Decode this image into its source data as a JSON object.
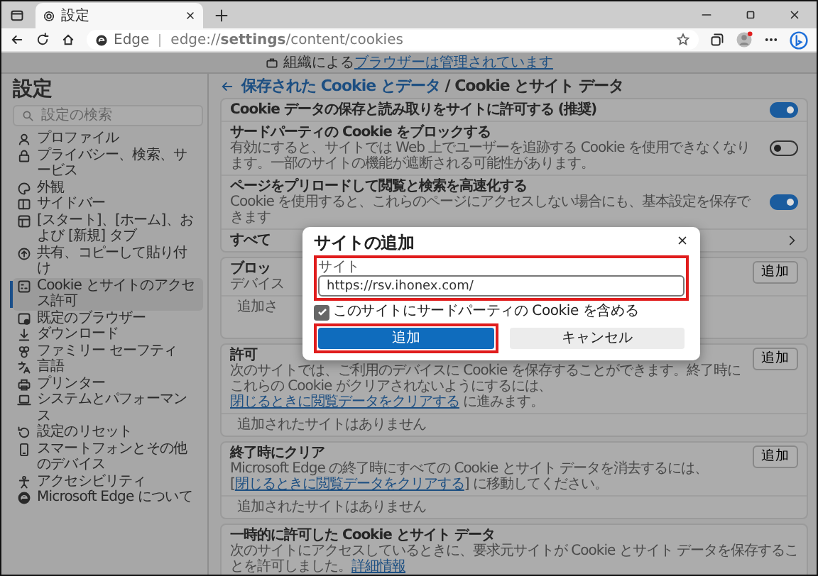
{
  "browser": {
    "tab": {
      "title": "設定"
    },
    "address": {
      "site_label": "Edge",
      "url": "edge://**settings**/content/cookies"
    }
  },
  "managed_notice": {
    "text": "組織による",
    "link": "ブラウザーは管理されています"
  },
  "sidebar": {
    "title": "設定",
    "search": {
      "placeholder": "設定の検索"
    },
    "items": [
      {
        "label": "プロファイル",
        "selected": false
      },
      {
        "label": "プライバシー、検索、サービス",
        "selected": false
      },
      {
        "label": "外観",
        "selected": false
      },
      {
        "label": "サイドバー",
        "selected": false
      },
      {
        "label": "[スタート]、[ホーム]、および [新規] タブ",
        "selected": false
      },
      {
        "label": "共有、コピーして貼り付け",
        "selected": false
      },
      {
        "label": "Cookie とサイトのアクセス許可",
        "selected": true
      },
      {
        "label": "既定のブラウザー",
        "selected": false
      },
      {
        "label": "ダウンロード",
        "selected": false
      },
      {
        "label": "ファミリー セーフティ",
        "selected": false
      },
      {
        "label": "言語",
        "selected": false
      },
      {
        "label": "プリンター",
        "selected": false
      },
      {
        "label": "システムとパフォーマンス",
        "selected": false
      },
      {
        "label": "設定のリセット",
        "selected": false
      },
      {
        "label": "スマートフォンとその他のデバイス",
        "selected": false
      },
      {
        "label": "アクセシビリティ",
        "selected": false
      },
      {
        "label": "Microsoft Edge について",
        "selected": false
      }
    ]
  },
  "page": {
    "breadcrumb_link": "保存された Cookie とデータ",
    "title": "/ Cookie とサイト データ"
  },
  "settings": [
    {
      "title": "Cookie データの保存と読み取りをサイトに許可する (推奨)",
      "on": true
    },
    {
      "title": "サードパーティの Cookie をブロックする",
      "description": "有効にすると、サイトでは Web 上でユーザーを追跡する Cookie を使用できなくなります。一部のサイトの機能が遮断される可能性があります。",
      "on": false
    },
    {
      "title": "ページをプリロードして閲覧と検索を高速化する",
      "description": "Cookie を使用すると、これらのページにアクセスしない場合にも、基本設定を保存できます",
      "on": true
    }
  ],
  "all_row": {
    "label": "すべて"
  },
  "sections": [
    {
      "title": "ブロッ",
      "description": "デバイス",
      "empty": "追加さ",
      "button": "追加"
    },
    {
      "title": "許可",
      "description": "次のサイトでは、ご利用のデバイスに Cookie を保存することができます。終了時にこれらの Cookie がクリアされないようにするには、",
      "link": "閉じるときに閲覧データをクリアする",
      "after": " に進みます。",
      "empty": "追加されたサイトはありません",
      "button": "追加"
    },
    {
      "title": "終了時にクリア",
      "description": "Microsoft Edge の終了時にすべての Cookie とサイト データを消去するには、[",
      "link": "閉じるときに閲覧データをクリアする",
      "after": "] に移動してください。",
      "empty": "追加されたサイトはありません",
      "button": "追加"
    },
    {
      "title": "一時的に許可した Cookie とサイト データ",
      "description": "次のサイトにアクセスしているときに、要求元サイトが Cookie とサイト データを保存することを許可しました。",
      "link": "詳細情報"
    }
  ],
  "dialog": {
    "title": "サイトの追加",
    "field": {
      "label": "サイト",
      "value": "https://rsv.ihonex.com/",
      "highlighted": true
    },
    "checkbox": {
      "label": "このサイトにサードパーティの Cookie を含める",
      "checked": true
    },
    "buttons": [
      {
        "label": "追加",
        "kind": "primary",
        "highlighted": true
      },
      {
        "label": "キャンセル",
        "kind": "secondary",
        "highlighted": false
      }
    ]
  }
}
